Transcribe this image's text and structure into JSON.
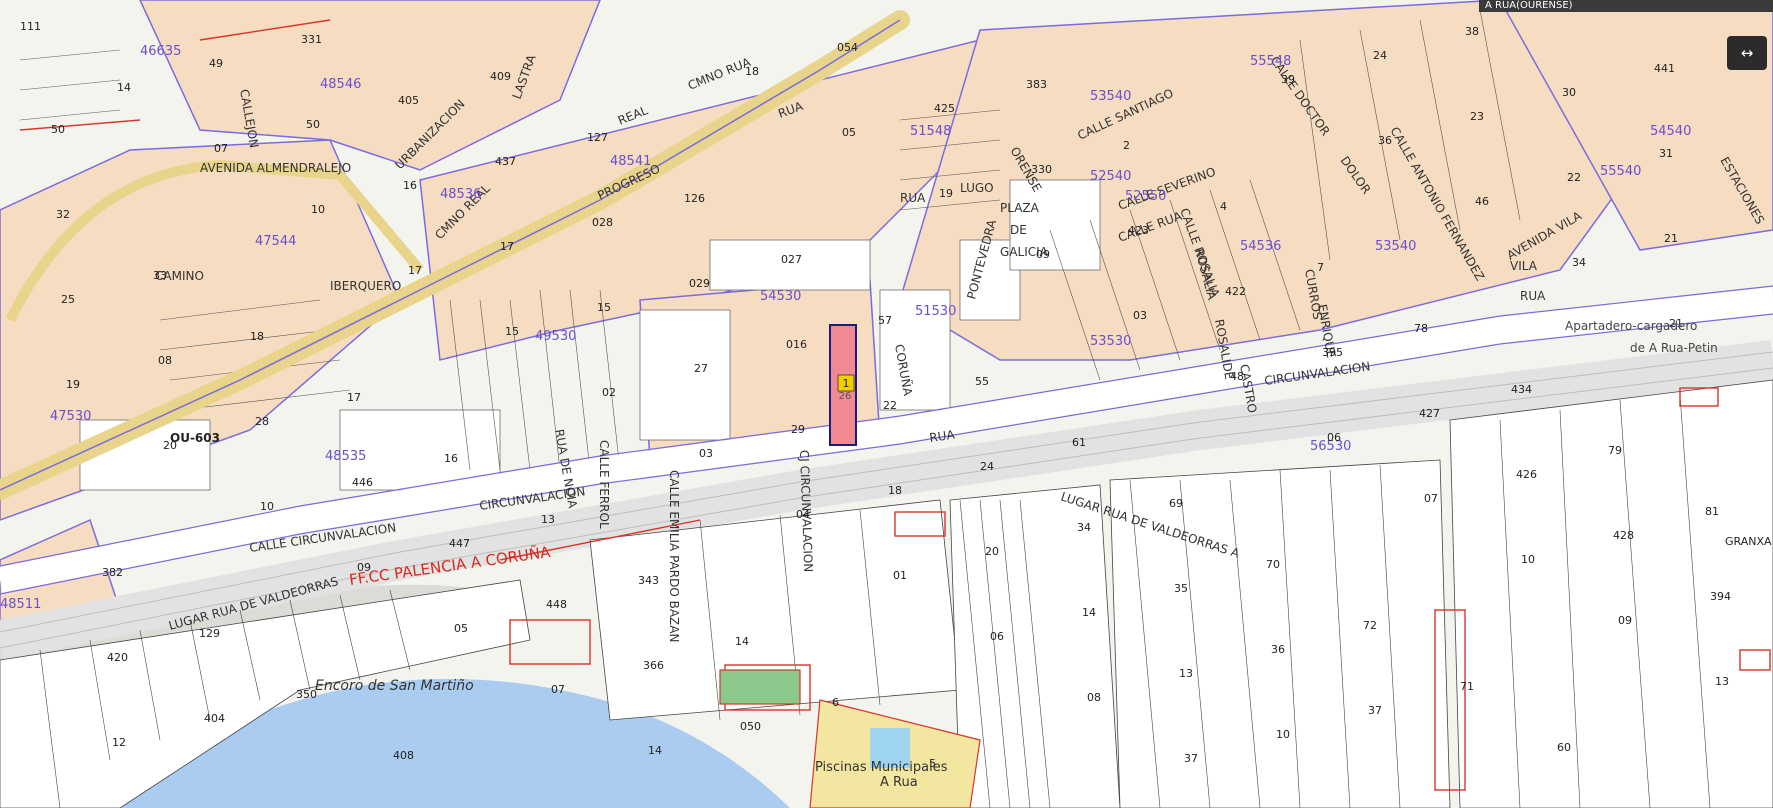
{
  "viewer": {
    "location_label": "A RUA(OURENSE)",
    "expand_icon": "arrow-expand-icon"
  },
  "colors": {
    "background": "#f4f4ee",
    "urban_block": "#f6dcc0",
    "purple_outline": "#7b6be0",
    "main_road": "#e8d48a",
    "red_parcel": "#d9342b",
    "water": "#a9ccf0",
    "selected_parcel": "#f08a92",
    "marker": "#f2d000",
    "railway": "#e2e2e2",
    "sports": "#8cc78c",
    "label_purple": "#6a4fd0",
    "label_red": "#d62a1e"
  },
  "marker": {
    "number": "1",
    "parcel_code": "26"
  },
  "streets": [
    "CMNO RUA",
    "REAL",
    "PROGRESO",
    "RUA",
    "AVENIDA ALMENDRALEJO",
    "ORENSE",
    "LUGO",
    "RUA",
    "CALLE SANTIAGO",
    "CALLE DOCTOR",
    "DOLOR",
    "CALLE SEVERINO",
    "CALLE RUA",
    "CALLE ROSALIA",
    "ROSALIA",
    "PLAZA",
    "DE",
    "GALICIA",
    "PONTEVEDRA",
    "CORUÑA",
    "CURROS",
    "ENRIQUE",
    "ROSALIDE",
    "CASTRO",
    "CIRCUNVALACION",
    "CALLE CIRCUNVALACION",
    "RUA",
    "CIRCUNVALACION",
    "LUGAR RUA DE VALDEORRAS A",
    "LUGAR RUA DE VALDEORRAS",
    "CALLE FERROL",
    "RUA DE NOIA",
    "CALLE EMILIA PARDO BAZAN",
    "CJ CIRCUNVALACION",
    "CMNO REAL",
    "CAMINO",
    "IBERQUERO",
    "CALLEJON",
    "URBANIZACION",
    "LASTRA",
    "AVENIDA VILA",
    "CALLE ANTONIO FERNANDEZ",
    "ESTACIONES",
    "VILA",
    "RUA"
  ],
  "cadastral_zones": [
    "46635",
    "48546",
    "47544",
    "49530",
    "47530",
    "48535",
    "48541",
    "48536",
    "51548",
    "52540",
    "54530",
    "51530",
    "53540",
    "52550",
    "55540",
    "53540",
    "54540",
    "55548",
    "54536",
    "53530",
    "56530",
    "48511"
  ],
  "road_badge": "OU-603",
  "railway_label": "FF.CC PALENCIA A CORUÑA",
  "water_label": "Encoro de San Martiño",
  "station_label": [
    "Apartadero-cargadero",
    "de A Rua-Petin"
  ],
  "pool_label": [
    "Piscinas Municipales",
    "A Rua"
  ],
  "place_label": "GRANXA",
  "parcel_numbers": [
    "111",
    "14",
    "07",
    "10",
    "17",
    "15",
    "02",
    "03",
    "04",
    "01",
    "06",
    "08",
    "37",
    "39",
    "36",
    "46",
    "34",
    "21",
    "19",
    "20",
    "10",
    "09",
    "05",
    "07",
    "14",
    "18",
    "05",
    "19",
    "09",
    "03",
    "48",
    "06",
    "07",
    "10",
    "09",
    "13",
    "12",
    "49",
    "50",
    "16",
    "17",
    "15",
    "27",
    "29",
    "18",
    "20",
    "14",
    "13",
    "10",
    "24",
    "23",
    "22",
    "21",
    "25",
    "08",
    "28",
    "446",
    "447",
    "448",
    "366",
    "050",
    "054",
    "425",
    "330",
    "423",
    "422",
    "395",
    "427",
    "426",
    "428",
    "394",
    "420",
    "404",
    "331",
    "405",
    "437",
    "028",
    "029",
    "016",
    "22",
    "24",
    "34",
    "35",
    "36",
    "37",
    "38",
    "30",
    "31",
    "32",
    "33",
    "18",
    "17",
    "16",
    "13",
    "343",
    "14",
    "6",
    "5",
    "383",
    "2",
    "4",
    "7",
    "78",
    "434",
    "79",
    "81",
    "382",
    "129",
    "350",
    "408",
    "409",
    "127",
    "126",
    "027",
    "57",
    "55",
    "61",
    "69",
    "70",
    "72",
    "71",
    "60",
    "441",
    "50"
  ]
}
